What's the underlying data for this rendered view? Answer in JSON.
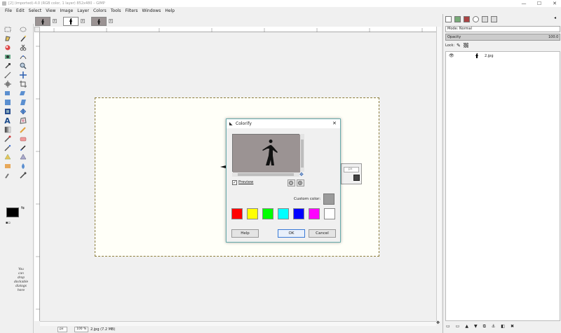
{
  "window": {
    "title": "[2] (imported)-4.0 (RGB color, 1 layer) 852x480 – GIMP",
    "minimize": "—",
    "maximize": "☐",
    "close": "✕"
  },
  "menu": [
    "File",
    "Edit",
    "Select",
    "View",
    "Image",
    "Layer",
    "Colors",
    "Tools",
    "Filters",
    "Windows",
    "Help"
  ],
  "toolbox": {
    "hint": [
      "You",
      "can",
      "drop",
      "dockable",
      "dialogs",
      "here"
    ]
  },
  "statusbar": {
    "unit": "px",
    "zoom": "100 %",
    "file_info": "2.jpg (7.2 MB)"
  },
  "dock": {
    "mode_label": "Mode: Normal",
    "opacity_label": "Opacity",
    "opacity_value": "100.0",
    "lock_label": "Lock:",
    "layer_name": "2.jpg"
  },
  "hidden_dialog": {
    "unit": "px"
  },
  "dialog": {
    "title": "Colorify",
    "preview_label": "Preview",
    "custom_color_label": "Custom color:",
    "help_button": "Help",
    "ok_button": "OK",
    "cancel_button": "Cancel",
    "swatch_colors": [
      "#ff0000",
      "#ffff00",
      "#00ff00",
      "#00ffff",
      "#0000ff",
      "#ff00ff",
      "#ffffff"
    ],
    "custom_color": "#9b9b9b",
    "preview_bg": "#9b9393"
  }
}
